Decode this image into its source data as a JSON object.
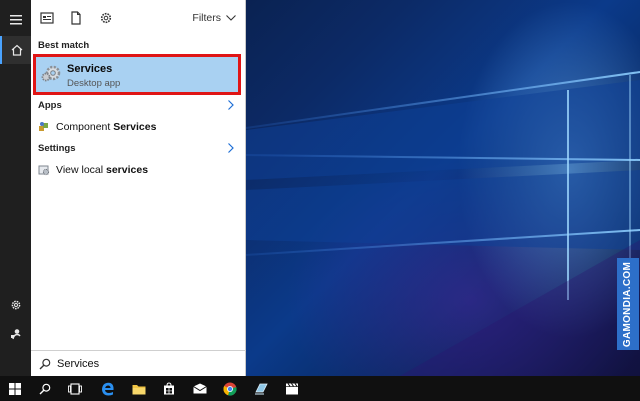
{
  "toolbar": {
    "filters_label": "Filters"
  },
  "sections": {
    "best_match": "Best match",
    "apps": "Apps",
    "settings": "Settings"
  },
  "best_match_item": {
    "title": "Services",
    "subtitle": "Desktop app"
  },
  "apps_item": {
    "prefix": "Component ",
    "bold": "Services"
  },
  "settings_item": {
    "prefix": "View local ",
    "bold": "services"
  },
  "search": {
    "value": "Services"
  },
  "watermark": {
    "text": "GAMONDIA.COM"
  },
  "colors": {
    "highlight": "#a9d1f2",
    "selection_border": "#e01515",
    "link_chevron": "#1e6fd6",
    "taskbar": "#101010",
    "rail": "#1f1f1f"
  },
  "icons": {
    "rail": [
      "hamburger-icon",
      "home-icon",
      "gear-icon",
      "user-icon"
    ],
    "taskbar": [
      "windows-start-icon",
      "search-icon",
      "task-view-icon",
      "edge-icon",
      "file-explorer-icon",
      "store-icon",
      "mail-icon",
      "chrome-icon",
      "app-icon",
      "clapper-icon"
    ]
  }
}
